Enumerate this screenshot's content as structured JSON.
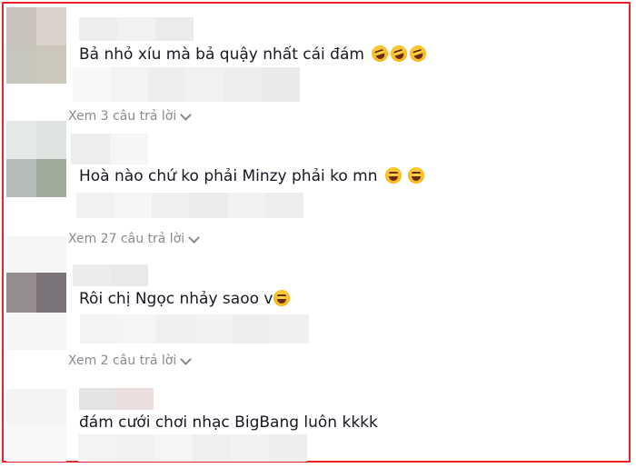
{
  "comments": [
    {
      "text": "Bả nhỏ xíu mà bả quậy nhất cái đám",
      "emoji": [
        "rofl-emoji",
        "rofl-emoji",
        "rofl-emoji"
      ],
      "replies": "Xem 3 câu trả lời"
    },
    {
      "text": "Hoà nào chứ ko phải Minzy phải ko mn",
      "emoji": [
        "grin-sweat-emoji",
        "grin-sweat-emoji"
      ],
      "replies": "Xem 27 câu trả lời"
    },
    {
      "text": "Rôi chị Ngọc nhảy saoo v",
      "emoji": [
        "joy-emoji"
      ],
      "replies": "Xem 2 câu trả lời"
    },
    {
      "text": "đám cưới chơi nhạc BigBang luôn kkkk",
      "emoji": [],
      "replies": ""
    }
  ],
  "colors": {
    "frame": "#e8242a",
    "text": "#161823",
    "muted": "#8a8b91"
  }
}
